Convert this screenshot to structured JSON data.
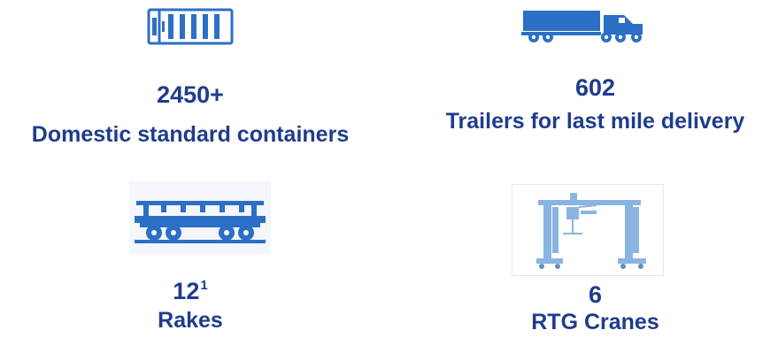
{
  "colors": {
    "text": "#1f3c8c",
    "icon_blue": "#2c6fc7",
    "crane_blue": "#8ab4e2"
  },
  "stats": {
    "containers": {
      "icon": "shipping-container-icon",
      "value": "2450+",
      "label": "Domestic standard containers"
    },
    "trailers": {
      "icon": "truck-trailer-icon",
      "value": "602",
      "label": "Trailers for last mile delivery"
    },
    "rakes": {
      "icon": "rail-wagon-icon",
      "value": "12",
      "value_sup": "1",
      "label": "Rakes"
    },
    "cranes": {
      "icon": "rtg-crane-icon",
      "value": "6",
      "label": "RTG Cranes"
    }
  }
}
